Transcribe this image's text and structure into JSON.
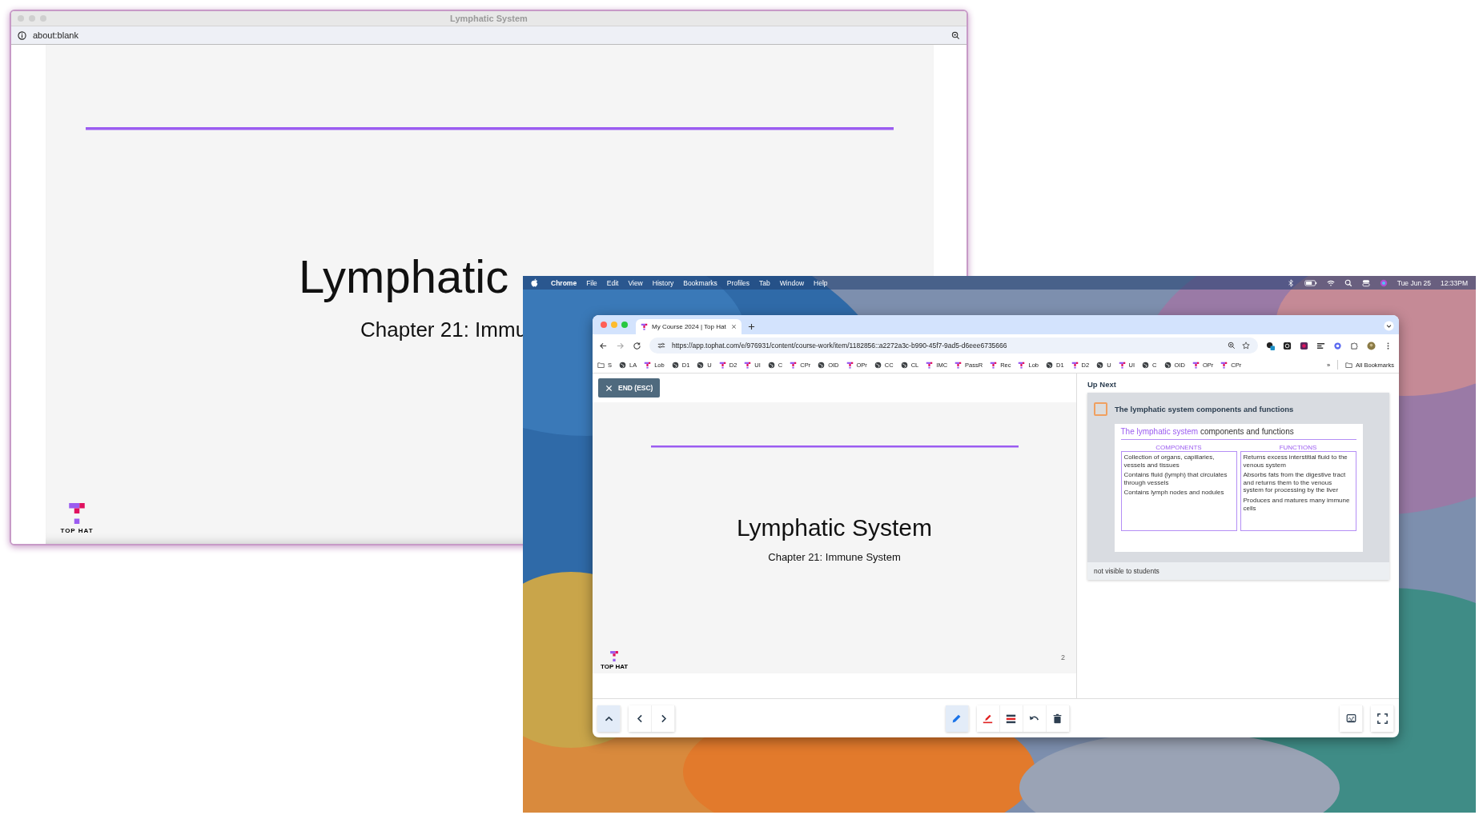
{
  "background_window": {
    "title": "Lymphatic System",
    "address": "about:blank",
    "slide": {
      "title": "Lymphatic",
      "subtitle": "Chapter 21: Immu",
      "logo_text": "TOP HAT"
    }
  },
  "menu_bar": {
    "app": "Chrome",
    "items": [
      "File",
      "Edit",
      "View",
      "History",
      "Bookmarks",
      "Profiles",
      "Tab",
      "Window",
      "Help"
    ],
    "date": "Tue Jun 25",
    "time": "12:33PM"
  },
  "browser": {
    "tab": {
      "title": "My Course 2024 | Top Hat",
      "selected": true
    },
    "address": "https://app.tophat.com/e/976931/content/course-work/item/1182856::a2272a3c-b990-45f7-9ad5-d6eee6735666",
    "bookmarks": [
      {
        "label": "S",
        "kind": "folder"
      },
      {
        "label": "LA",
        "kind": "globe"
      },
      {
        "label": "Lob",
        "kind": "tophat"
      },
      {
        "label": "D1",
        "kind": "globe"
      },
      {
        "label": "U",
        "kind": "globe"
      },
      {
        "label": "D2",
        "kind": "tophat"
      },
      {
        "label": "UI",
        "kind": "tophat"
      },
      {
        "label": "C",
        "kind": "globe"
      },
      {
        "label": "CPr",
        "kind": "tophat"
      },
      {
        "label": "OID",
        "kind": "globe"
      },
      {
        "label": "OPr",
        "kind": "tophat"
      },
      {
        "label": "CC",
        "kind": "globe"
      },
      {
        "label": "CL",
        "kind": "globe"
      },
      {
        "label": "IMC",
        "kind": "tophat"
      },
      {
        "label": "PassR",
        "kind": "tophat"
      },
      {
        "label": "Rec",
        "kind": "tophat"
      },
      {
        "label": "Lob",
        "kind": "tophat"
      },
      {
        "label": "D1",
        "kind": "globe"
      },
      {
        "label": "D2",
        "kind": "tophat"
      },
      {
        "label": "U",
        "kind": "globe"
      },
      {
        "label": "UI",
        "kind": "tophat"
      },
      {
        "label": "C",
        "kind": "globe"
      },
      {
        "label": "OID",
        "kind": "globe"
      },
      {
        "label": "OPr",
        "kind": "tophat"
      },
      {
        "label": "CPr",
        "kind": "tophat"
      }
    ],
    "overflow": "»",
    "all_bookmarks": "All Bookmarks"
  },
  "presenter": {
    "end_button": "END (ESC)",
    "slide": {
      "title": "Lymphatic System",
      "subtitle": "Chapter 21: Immune System",
      "logo_text": "TOP HAT",
      "page": "2"
    },
    "up_next": {
      "heading": "Up Next",
      "item_title": "The lymphatic system components and functions",
      "visibility": "not visible to students",
      "thumbnail": {
        "title_highlight": "The lymphatic system",
        "title_rest": "components and functions",
        "columns": [
          {
            "heading": "COMPONENTS",
            "bullets": [
              "Collection of organs, capillaries, vessels and tissues",
              "Contains fluid (lymph) that circulates through vessels",
              "Contains lymph nodes and nodules"
            ]
          },
          {
            "heading": "FUNCTIONS",
            "bullets": [
              "Returns excess interstitial fluid to the venous system",
              "Absorbs fats from the digestive tract and returns them to the venous system for processing by the liver",
              "Produces and matures many immune cells"
            ]
          }
        ]
      }
    },
    "toolbar": {
      "groups": [
        [
          {
            "kind": "collapse",
            "selected": true
          }
        ],
        [
          {
            "kind": "previous",
            "selected": false
          },
          {
            "kind": "next",
            "selected": false
          }
        ],
        [
          {
            "kind": "pen",
            "selected": true
          }
        ],
        [
          {
            "kind": "highlighter",
            "selected": false
          },
          {
            "kind": "line-weight",
            "selected": false
          },
          {
            "kind": "undo",
            "selected": false
          },
          {
            "kind": "delete",
            "selected": false
          }
        ],
        [
          {
            "kind": "whiteboard",
            "selected": false
          }
        ],
        [
          {
            "kind": "fullscreen",
            "selected": false
          }
        ]
      ]
    }
  }
}
